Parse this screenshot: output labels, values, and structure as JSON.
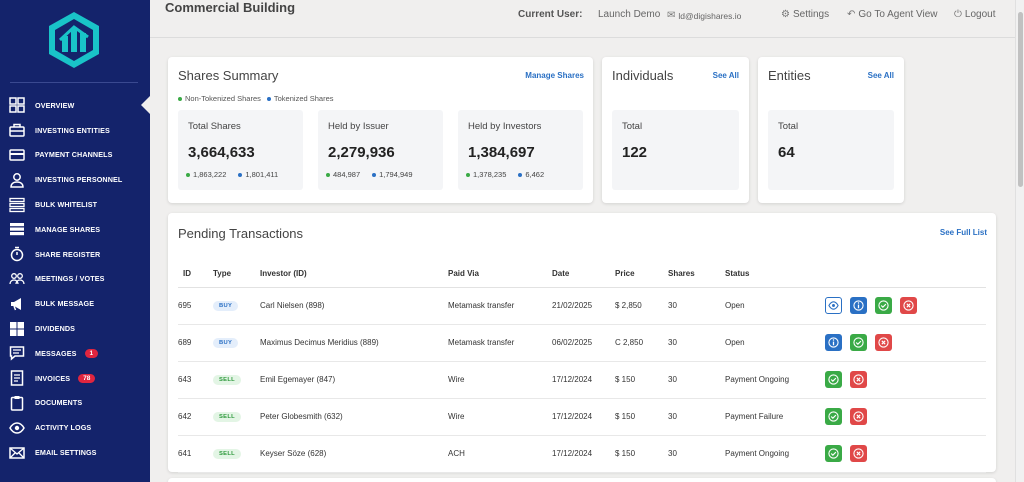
{
  "header": {
    "title": "Commercial Building",
    "current_user_label": "Current User:",
    "user_name": "Launch Demo",
    "user_email": "ld@digishares.io",
    "settings_label": "Settings",
    "agent_view_label": "Go To Agent View",
    "logout_label": "Logout"
  },
  "sidebar": {
    "items": [
      {
        "label": "OVERVIEW",
        "icon": "grid-icon",
        "active": true
      },
      {
        "label": "INVESTING ENTITIES",
        "icon": "briefcase-icon"
      },
      {
        "label": "PAYMENT CHANNELS",
        "icon": "credit-card-icon"
      },
      {
        "label": "INVESTING PERSONNEL",
        "icon": "user-icon"
      },
      {
        "label": "BULK WHITELIST",
        "icon": "list-icon"
      },
      {
        "label": "MANAGE SHARES",
        "icon": "database-icon"
      },
      {
        "label": "SHARE REGISTER",
        "icon": "stopwatch-icon"
      },
      {
        "label": "MEETINGS / VOTES",
        "icon": "users-icon"
      },
      {
        "label": "BULK MESSAGE",
        "icon": "megaphone-icon"
      },
      {
        "label": "DIVIDENDS",
        "icon": "tiles-icon"
      },
      {
        "label": "MESSAGES",
        "icon": "chat-icon",
        "badge": "1"
      },
      {
        "label": "INVOICES",
        "icon": "receipt-icon",
        "badge": "78"
      },
      {
        "label": "DOCUMENTS",
        "icon": "clipboard-icon"
      },
      {
        "label": "ACTIVITY LOGS",
        "icon": "eye-icon"
      },
      {
        "label": "EMAIL SETTINGS",
        "icon": "mail-icon"
      }
    ]
  },
  "shares_summary": {
    "title": "Shares Summary",
    "link": "Manage Shares",
    "legend_non_tokenized": "Non-Tokenized Shares",
    "legend_tokenized": "Tokenized Shares",
    "stats": [
      {
        "label": "Total Shares",
        "value": "3,664,633",
        "non_tokenized": "1,863,222",
        "tokenized": "1,801,411"
      },
      {
        "label": "Held by Issuer",
        "value": "2,279,936",
        "non_tokenized": "484,987",
        "tokenized": "1,794,949"
      },
      {
        "label": "Held by Investors",
        "value": "1,384,697",
        "non_tokenized": "1,378,235",
        "tokenized": "6,462"
      }
    ]
  },
  "individuals": {
    "title": "Individuals",
    "link": "See All",
    "label": "Total",
    "value": "122"
  },
  "entities": {
    "title": "Entities",
    "link": "See All",
    "label": "Total",
    "value": "64"
  },
  "pending": {
    "title": "Pending Transactions",
    "link": "See Full List",
    "columns": [
      "ID",
      "Type",
      "Investor (ID)",
      "Paid Via",
      "Date",
      "Price",
      "Shares",
      "Status"
    ],
    "rows": [
      {
        "id": "695",
        "type": "BUY",
        "investor": "Carl Nielsen (898)",
        "paid_via": "Metamask transfer",
        "date": "21/02/2025",
        "price": "$ 2,850",
        "shares": "30",
        "status": "Open",
        "actions": [
          "view",
          "info",
          "approve",
          "reject"
        ]
      },
      {
        "id": "689",
        "type": "BUY",
        "investor": "Maximus Decimus Meridius (889)",
        "paid_via": "Metamask transfer",
        "date": "06/02/2025",
        "price": "C 2,850",
        "shares": "30",
        "status": "Open",
        "actions": [
          "info",
          "approve",
          "reject"
        ]
      },
      {
        "id": "643",
        "type": "SELL",
        "investor": "Emil Egemayer (847)",
        "paid_via": "Wire",
        "date": "17/12/2024",
        "price": "$ 150",
        "shares": "30",
        "status": "Payment Ongoing",
        "actions": [
          "approve",
          "reject"
        ]
      },
      {
        "id": "642",
        "type": "SELL",
        "investor": "Peter Globesmith (632)",
        "paid_via": "Wire",
        "date": "17/12/2024",
        "price": "$ 150",
        "shares": "30",
        "status": "Payment Failure",
        "actions": [
          "approve",
          "reject"
        ]
      },
      {
        "id": "641",
        "type": "SELL",
        "investor": "Keyser Söze (628)",
        "paid_via": "ACH",
        "date": "17/12/2024",
        "price": "$ 150",
        "shares": "30",
        "status": "Payment Ongoing",
        "actions": [
          "approve",
          "reject"
        ]
      }
    ]
  },
  "colors": {
    "sidebar": "#14236b",
    "accent": "#2a70c4",
    "green": "#3aaa46",
    "red": "#e04848",
    "badge": "#e0253f",
    "logo": "#19c3c8"
  }
}
